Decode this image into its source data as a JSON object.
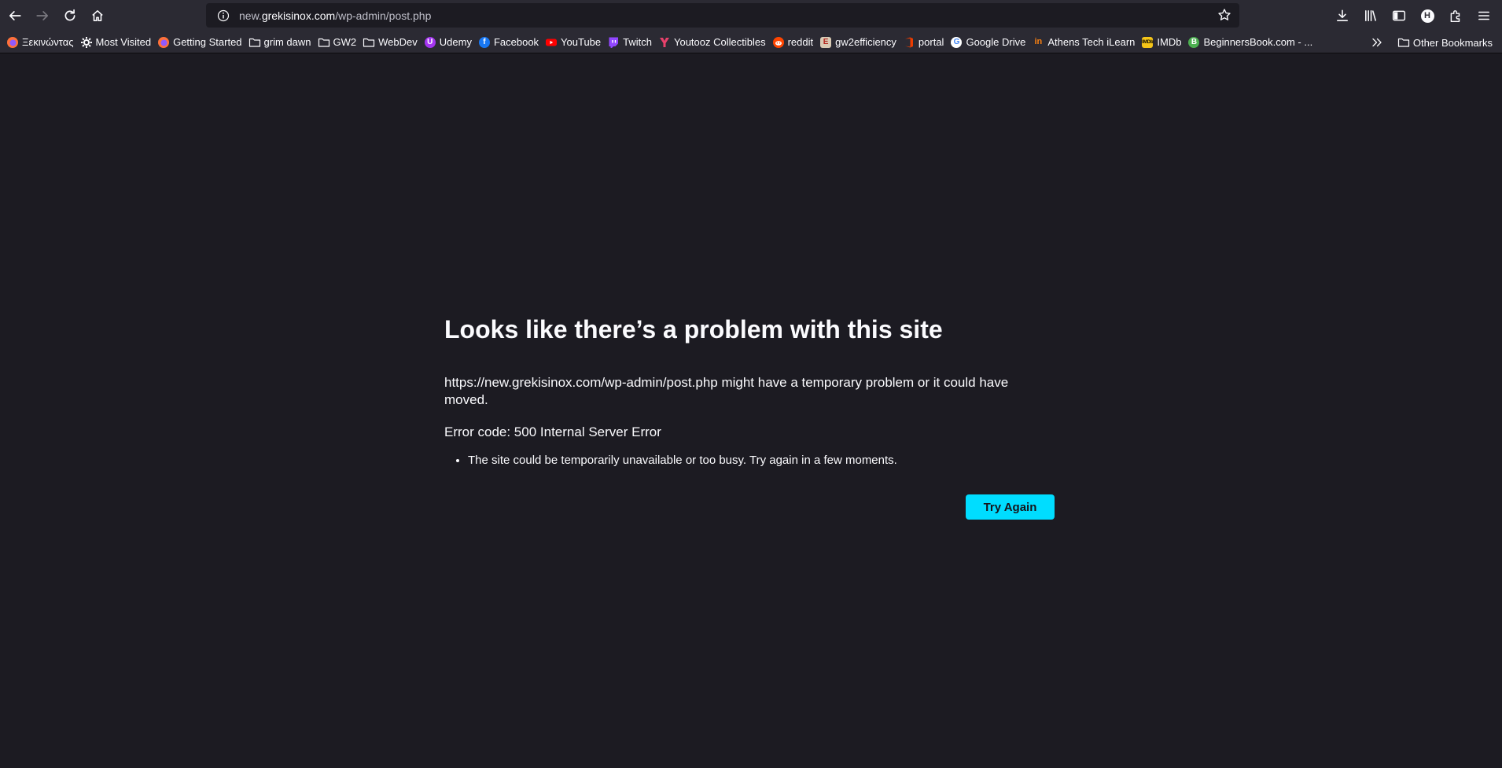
{
  "url": {
    "prefix": "new.",
    "domain": "grekisinox.com",
    "path": "/wp-admin/post.php"
  },
  "bookmarks": [
    {
      "label": "Ξεκινώντας",
      "icon": "firefox-icon"
    },
    {
      "label": "Most Visited",
      "icon": "gear-icon"
    },
    {
      "label": "Getting Started",
      "icon": "firefox-icon"
    },
    {
      "label": "grim dawn",
      "icon": "folder-icon"
    },
    {
      "label": "GW2",
      "icon": "folder-icon"
    },
    {
      "label": "WebDev",
      "icon": "folder-icon"
    },
    {
      "label": "Udemy",
      "icon": "udemy-icon"
    },
    {
      "label": "Facebook",
      "icon": "facebook-icon"
    },
    {
      "label": "YouTube",
      "icon": "youtube-icon"
    },
    {
      "label": "Twitch",
      "icon": "twitch-icon"
    },
    {
      "label": "Youtooz Collectibles",
      "icon": "youtooz-icon"
    },
    {
      "label": "reddit",
      "icon": "reddit-icon"
    },
    {
      "label": "gw2efficiency",
      "icon": "gw2efficiency-icon"
    },
    {
      "label": "portal",
      "icon": "office-icon"
    },
    {
      "label": "Google Drive",
      "icon": "google-icon"
    },
    {
      "label": "Athens Tech iLearn",
      "icon": "ilearn-icon"
    },
    {
      "label": "IMDb",
      "icon": "imdb-icon"
    },
    {
      "label": "BeginnersBook.com - ...",
      "icon": "beginnersbook-icon"
    }
  ],
  "other_bookmarks": "Other Bookmarks",
  "error": {
    "title": "Looks like there’s a problem with this site",
    "description": "https://new.grekisinox.com/wp-admin/post.php might have a temporary problem or it could have moved.",
    "code": "Error code: 500 Internal Server Error",
    "tips": [
      "The site could be temporarily unavailable or too busy. Try again in a few moments."
    ],
    "button": "Try Again"
  },
  "profile_initial": "H",
  "colors": {
    "page_bg": "#1c1b22",
    "toolbar_bg": "#2b2a33",
    "accent": "#00ddff"
  }
}
